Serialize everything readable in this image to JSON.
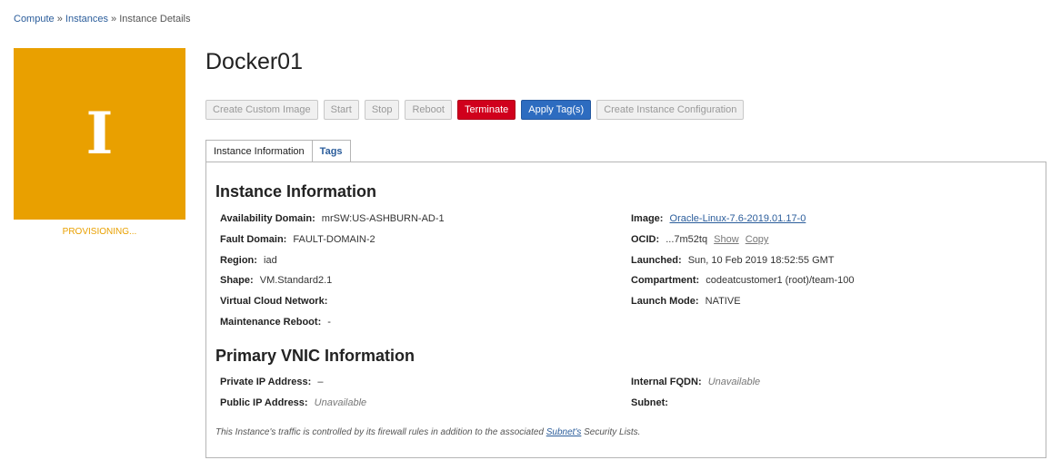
{
  "breadcrumb": {
    "compute": "Compute",
    "instances": "Instances",
    "current": "Instance Details",
    "separator": "»"
  },
  "tile": {
    "letter": "I",
    "state": "PROVISIONING...",
    "color": "#e9a000"
  },
  "title": "Docker01",
  "actions": {
    "create_image": "Create Custom Image",
    "start": "Start",
    "stop": "Stop",
    "reboot": "Reboot",
    "terminate": "Terminate",
    "apply_tags": "Apply Tag(s)",
    "create_config": "Create Instance Configuration"
  },
  "tabs": {
    "info": "Instance Information",
    "tags": "Tags"
  },
  "instance_info": {
    "heading": "Instance Information",
    "availability_domain": {
      "label": "Availability Domain:",
      "value": "mrSW:US-ASHBURN-AD-1"
    },
    "fault_domain": {
      "label": "Fault Domain:",
      "value": "FAULT-DOMAIN-2"
    },
    "region": {
      "label": "Region:",
      "value": "iad"
    },
    "shape": {
      "label": "Shape:",
      "value": "VM.Standard2.1"
    },
    "vcn": {
      "label": "Virtual Cloud Network:",
      "value": ""
    },
    "maintenance_reboot": {
      "label": "Maintenance Reboot:",
      "value": "-"
    },
    "image": {
      "label": "Image:",
      "value": "Oracle-Linux-7.6-2019.01.17-0"
    },
    "ocid": {
      "label": "OCID:",
      "value": "...7m52tq",
      "show": "Show",
      "copy": "Copy"
    },
    "launched": {
      "label": "Launched:",
      "value": "Sun, 10 Feb 2019 18:52:55 GMT"
    },
    "compartment": {
      "label": "Compartment:",
      "value": "codeatcustomer1 (root)/team-100"
    },
    "launch_mode": {
      "label": "Launch Mode:",
      "value": "NATIVE"
    }
  },
  "vnic": {
    "heading": "Primary VNIC Information",
    "private_ip": {
      "label": "Private IP Address:",
      "value": "–"
    },
    "public_ip": {
      "label": "Public IP Address:",
      "value": "Unavailable"
    },
    "internal_fqdn": {
      "label": "Internal FQDN:",
      "value": "Unavailable"
    },
    "subnet": {
      "label": "Subnet:",
      "value": ""
    }
  },
  "note": {
    "before": "This Instance's traffic is controlled by its firewall rules in addition to the associated ",
    "link": "Subnet's",
    "after": " Security Lists."
  }
}
